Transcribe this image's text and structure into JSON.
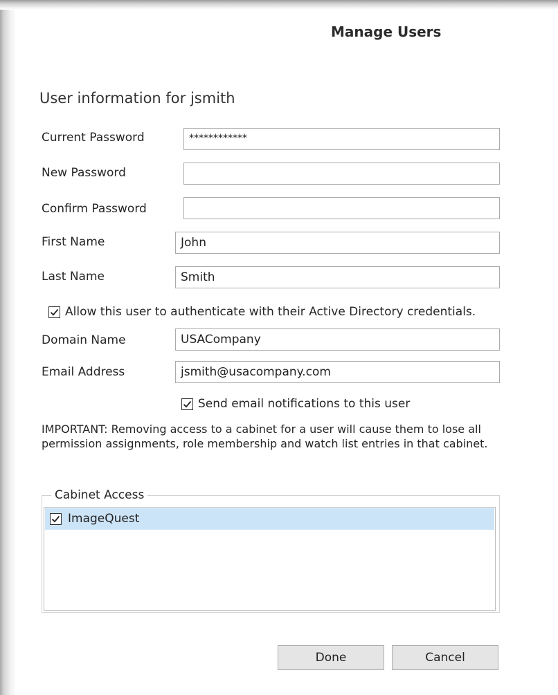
{
  "dialog": {
    "title": "Manage Users",
    "heading": "User information for jsmith"
  },
  "form": {
    "current_password": {
      "label": "Current Password",
      "value": "************"
    },
    "new_password": {
      "label": "New Password",
      "value": ""
    },
    "confirm_password": {
      "label": "Confirm Password",
      "value": ""
    },
    "first_name": {
      "label": "First Name",
      "value": "John"
    },
    "last_name": {
      "label": "Last Name",
      "value": "Smith"
    },
    "ad_auth": {
      "label": "Allow this user to authenticate with their Active Directory credentials.",
      "checked": true
    },
    "domain_name": {
      "label": "Domain Name",
      "value": "USACompany"
    },
    "email_address": {
      "label": "Email Address",
      "value": "jsmith@usacompany.com"
    },
    "email_notifications": {
      "label": "Send email notifications to this user",
      "checked": true
    }
  },
  "important_text": "IMPORTANT:  Removing access to a cabinet for a user will cause them to lose all permission assignments, role membership and watch list entries in that cabinet.",
  "cabinet_access": {
    "legend": "Cabinet Access",
    "items": [
      {
        "label": "ImageQuest",
        "checked": true,
        "selected": true
      }
    ]
  },
  "buttons": {
    "done": "Done",
    "cancel": "Cancel"
  },
  "colors": {
    "selection": "#cce4f7",
    "button_bg": "#e5e5e5",
    "border": "#ababab"
  }
}
